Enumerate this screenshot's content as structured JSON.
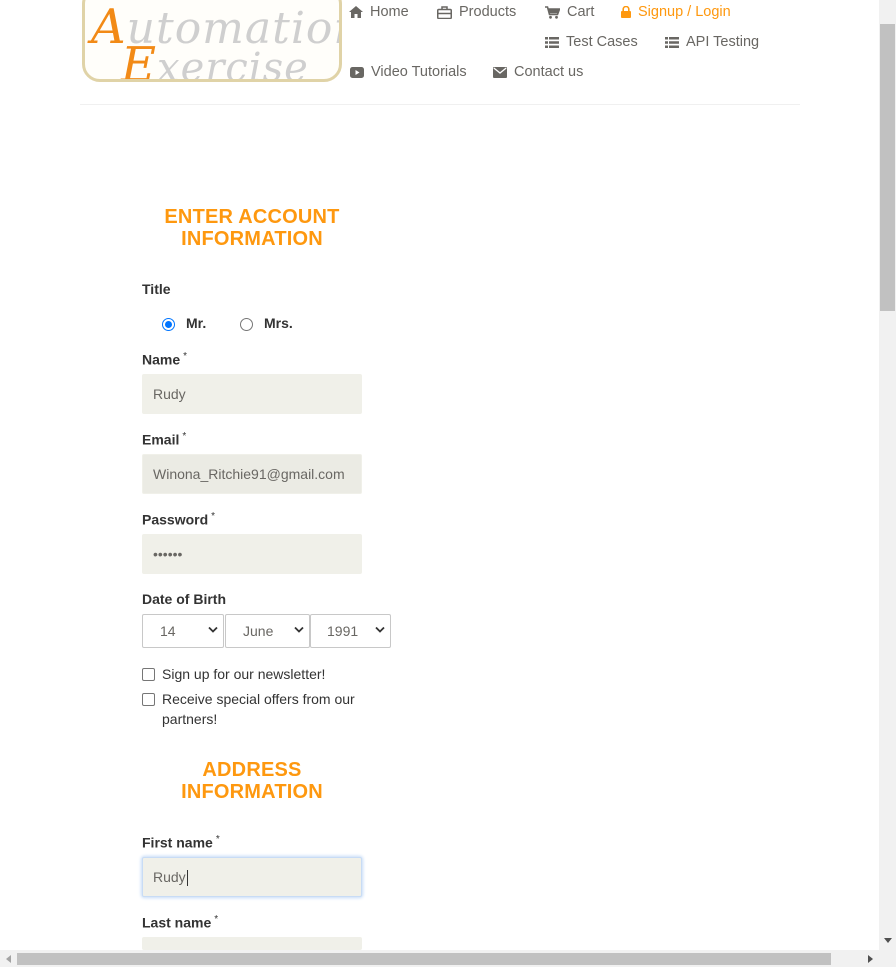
{
  "colors": {
    "accent": "#fe980f",
    "nav_text": "#696763",
    "field_bg": "#f0f0e9"
  },
  "header": {
    "logo": {
      "text_line1": "Automation",
      "text_line2": "Exercise"
    },
    "nav": {
      "home": {
        "label": "Home",
        "icon": "home-icon"
      },
      "products": {
        "label": "Products",
        "icon": "briefcase-icon"
      },
      "cart": {
        "label": "Cart",
        "icon": "cart-icon"
      },
      "signup": {
        "label": "Signup / Login",
        "icon": "lock-icon"
      },
      "test_cases": {
        "label": "Test Cases",
        "icon": "list-icon"
      },
      "api_testing": {
        "label": "API Testing",
        "icon": "list-icon"
      },
      "video_tutorials": {
        "label": "Video Tutorials",
        "icon": "youtube-icon"
      },
      "contact_us": {
        "label": "Contact us",
        "icon": "envelope-icon"
      }
    }
  },
  "account_section": {
    "title": "ENTER ACCOUNT INFORMATION",
    "title_label": "Title",
    "title_options": [
      {
        "label": "Mr.",
        "checked": true
      },
      {
        "label": "Mrs.",
        "checked": false
      }
    ],
    "name": {
      "label": "Name",
      "required_mark": "*",
      "value": "Rudy"
    },
    "email": {
      "label": "Email",
      "required_mark": "*",
      "value": "Winona_Ritchie91@gmail.com"
    },
    "password": {
      "label": "Password",
      "required_mark": "*",
      "value": "••••••"
    },
    "dob": {
      "label": "Date of Birth",
      "day": "14",
      "month": "June",
      "year": "1991"
    },
    "newsletter": {
      "label": "Sign up for our newsletter!",
      "checked": false
    },
    "offers": {
      "label_line1": "Receive special offers from our",
      "label_line2": "partners!",
      "checked": false
    }
  },
  "address_section": {
    "title_line1": "ADDRESS",
    "title_line2": "INFORMATION",
    "first_name": {
      "label": "First name",
      "required_mark": "*",
      "value": "Rudy"
    },
    "last_name": {
      "label": "Last name",
      "required_mark": "*",
      "value": ""
    }
  }
}
